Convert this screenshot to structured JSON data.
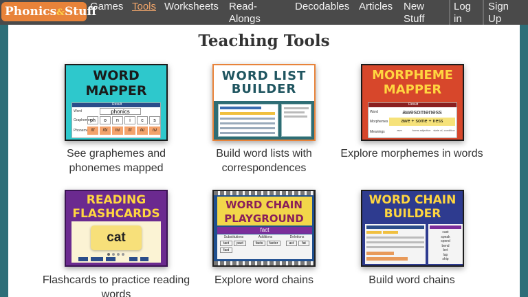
{
  "nav": {
    "logo_main": "Phonics",
    "logo_amp": "&",
    "logo_end": "Stuff",
    "links": [
      {
        "label": "Games"
      },
      {
        "label": "Tools",
        "active": true
      },
      {
        "label": "Worksheets"
      },
      {
        "label": "Read-\nAlongs"
      },
      {
        "label": "Decodables"
      },
      {
        "label": "Articles"
      },
      {
        "label": "New\nStuff"
      },
      {
        "label": "Log\nin"
      },
      {
        "label": "Sign\nUp"
      }
    ]
  },
  "page": {
    "title": "Teaching Tools"
  },
  "cards": [
    {
      "image_title": [
        "WORD",
        "MAPPER"
      ],
      "caption": "See graphemes and phonemes mapped",
      "preview": {
        "result_label": "Result",
        "row_labels": [
          "Word",
          "Graphemes",
          "Phonemes"
        ],
        "word": "phonics",
        "graphemes": [
          "ph",
          "o",
          "n",
          "i",
          "c",
          "s"
        ],
        "phonemes": [
          "/f/",
          "/ŏ/",
          "/n/",
          "/ĭ/",
          "/k/",
          "/s/"
        ]
      }
    },
    {
      "image_title": [
        "WORD LIST",
        "BUILDER"
      ],
      "caption": "Build word lists with correspondences"
    },
    {
      "image_title": [
        "MORPHEME",
        "MAPPER"
      ],
      "caption": "Explore morphemes in words",
      "preview": {
        "result_label": "Result",
        "row_labels": [
          "Word",
          "Morphemes",
          "Meanings"
        ],
        "word": "awesomeness",
        "morphemes": "awe + some + ness",
        "meanings": [
          "awe",
          "forms adjective",
          "state of, condition"
        ]
      }
    },
    {
      "image_title": [
        "READING",
        "FLASHCARDS"
      ],
      "caption": "Flashcards to practice reading words",
      "preview": {
        "card_word": "cat"
      }
    },
    {
      "image_title": [
        "WORD CHAIN",
        "PLAYGROUND"
      ],
      "caption": "Explore word chains",
      "preview": {
        "word": "fact",
        "columns": [
          "Substitutions",
          "Additions",
          "Deletions"
        ],
        "chips": [
          "tact",
          "pact",
          "fast",
          "facts",
          "factor",
          "act",
          "fat"
        ]
      }
    },
    {
      "image_title": [
        "WORD CHAIN",
        "BUILDER"
      ],
      "caption": "Build word chains",
      "preview": {
        "list": [
          "cast",
          "speak",
          "spend",
          "bend",
          "bet",
          "lap",
          "ship"
        ]
      }
    }
  ],
  "colors": {
    "nav_bg": "#4a4a4a",
    "logo_bg": "#e8833a",
    "accent": "#f0a56a",
    "page_bg": "#2d6e78"
  }
}
